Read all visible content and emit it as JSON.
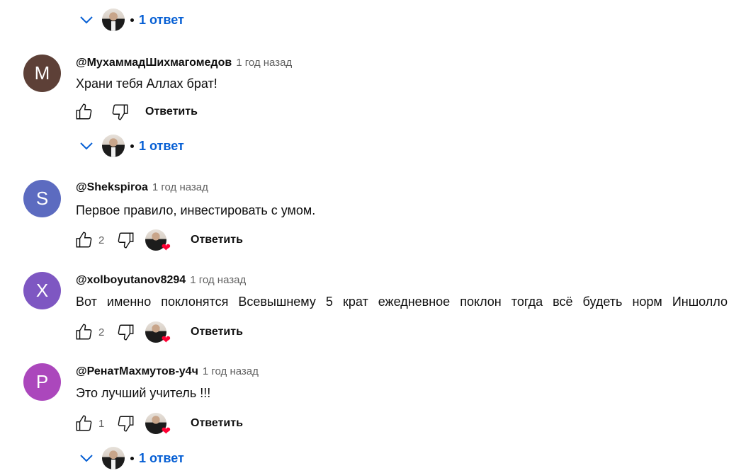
{
  "threads": [
    {
      "replies_label": "1 ответ"
    },
    {
      "avatar_letter": "M",
      "avatar_color": "#5d4037",
      "author": "@МухаммадШихмагомедов",
      "time": "1 год назад",
      "text": "Храни тебя Аллах брат!",
      "likes": "",
      "reply_label": "Ответить",
      "replies_label": "1 ответ"
    },
    {
      "avatar_letter": "S",
      "avatar_color": "#5c6bc0",
      "author": "@Shekspiroa",
      "time": "1 год назад",
      "text": "Первое правило, инвестировать с умом.",
      "likes": "2",
      "reply_label": "Ответить"
    },
    {
      "avatar_letter": "X",
      "avatar_color": "#7e57c2",
      "author": "@xolboyutanov8294",
      "time": "1 год назад",
      "text": "Вот именно поклонятся  Всевышнему 5 крат ежедневное  поклон  тогда всё будеть норм Иншолло",
      "likes": "2",
      "reply_label": "Ответить"
    },
    {
      "avatar_letter": "P",
      "avatar_color": "#ab47bc",
      "author": "@РенатМахмутов-у4ч",
      "time": "1 год назад",
      "text": "Это лучший учитель !!!",
      "likes": "1",
      "reply_label": "Ответить",
      "replies_label": "1 ответ"
    }
  ]
}
